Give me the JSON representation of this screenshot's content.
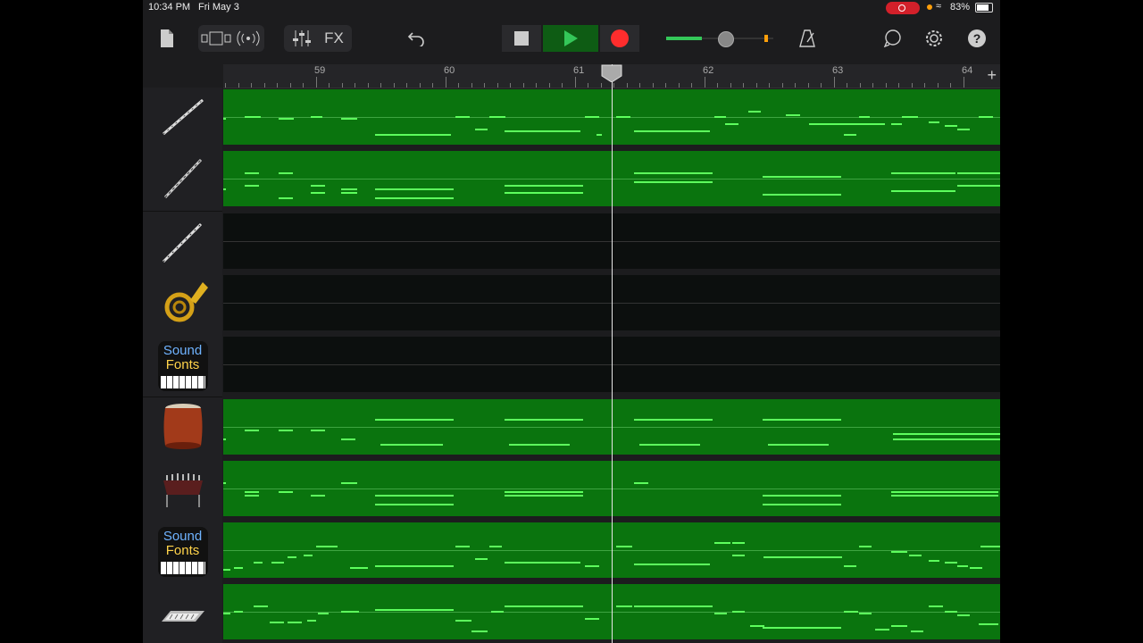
{
  "status": {
    "time": "10:34 PM",
    "date": "Fri May 3",
    "battery": "83%"
  },
  "toolbar": {
    "fx_label": "FX",
    "help_label": "?"
  },
  "ruler": {
    "bars": [
      "59",
      "60",
      "61",
      "62",
      "63",
      "64"
    ]
  },
  "tracks": [
    {
      "name": "bassoon",
      "icon": "bassoon-icon",
      "empty": false,
      "notes": [
        [
          0,
          32,
          3
        ],
        [
          24,
          30,
          18
        ],
        [
          62,
          32,
          17
        ],
        [
          98,
          30,
          13
        ],
        [
          132,
          32,
          18
        ],
        [
          170,
          50,
          85
        ],
        [
          260,
          30,
          16
        ],
        [
          282,
          44,
          14
        ],
        [
          298,
          30,
          18
        ],
        [
          315,
          46,
          85
        ],
        [
          405,
          30,
          16
        ],
        [
          418,
          50,
          6
        ],
        [
          440,
          30,
          16
        ],
        [
          460,
          46,
          85
        ],
        [
          550,
          30,
          13
        ],
        [
          562,
          38,
          15
        ],
        [
          588,
          24,
          14
        ],
        [
          630,
          28,
          16
        ],
        [
          656,
          38,
          85
        ],
        [
          695,
          50,
          14
        ],
        [
          712,
          30,
          12
        ],
        [
          748,
          38,
          12
        ],
        [
          760,
          30,
          18
        ],
        [
          790,
          36,
          12
        ],
        [
          808,
          40,
          14
        ],
        [
          822,
          44,
          14
        ],
        [
          846,
          30,
          16
        ]
      ]
    },
    {
      "name": "oboe",
      "icon": "oboe-icon",
      "empty": false,
      "notes": [
        [
          0,
          42,
          3
        ],
        [
          24,
          24,
          16
        ],
        [
          24,
          38,
          16
        ],
        [
          62,
          24,
          16
        ],
        [
          62,
          52,
          16
        ],
        [
          98,
          38,
          16
        ],
        [
          98,
          46,
          16
        ],
        [
          132,
          42,
          18
        ],
        [
          132,
          46,
          18
        ],
        [
          170,
          42,
          88
        ],
        [
          170,
          52,
          88
        ],
        [
          315,
          38,
          88
        ],
        [
          315,
          46,
          88
        ],
        [
          460,
          24,
          88
        ],
        [
          460,
          34,
          88
        ],
        [
          604,
          28,
          88
        ],
        [
          604,
          48,
          88
        ],
        [
          748,
          24,
          72
        ],
        [
          748,
          44,
          72
        ],
        [
          822,
          24,
          48
        ],
        [
          822,
          38,
          48
        ]
      ]
    },
    {
      "name": "clarinet",
      "icon": "clarinet-icon",
      "empty": true,
      "notes": []
    },
    {
      "name": "french-horn",
      "icon": "french-horn-icon",
      "empty": true,
      "notes": []
    },
    {
      "name": "soundfonts-piano",
      "icon": "soundfonts-icon",
      "label1": "Sound",
      "label2": "Fonts",
      "empty": true,
      "notes": []
    },
    {
      "name": "taiko-drum",
      "icon": "taiko-drum-icon",
      "empty": false,
      "notes": [
        [
          0,
          44,
          3
        ],
        [
          24,
          34,
          16
        ],
        [
          62,
          34,
          16
        ],
        [
          98,
          34,
          16
        ],
        [
          132,
          44,
          16
        ],
        [
          170,
          22,
          88
        ],
        [
          176,
          50,
          70
        ],
        [
          315,
          22,
          88
        ],
        [
          320,
          50,
          68
        ],
        [
          460,
          22,
          88
        ],
        [
          466,
          50,
          68
        ],
        [
          604,
          22,
          88
        ],
        [
          610,
          50,
          68
        ],
        [
          750,
          38,
          120
        ],
        [
          750,
          44,
          120
        ]
      ]
    },
    {
      "name": "vibraphone",
      "icon": "vibraphone-icon",
      "empty": false,
      "notes": [
        [
          0,
          24,
          3
        ],
        [
          24,
          34,
          16
        ],
        [
          24,
          38,
          16
        ],
        [
          62,
          34,
          16
        ],
        [
          98,
          38,
          16
        ],
        [
          132,
          24,
          18
        ],
        [
          170,
          38,
          88
        ],
        [
          170,
          48,
          88
        ],
        [
          315,
          34,
          88
        ],
        [
          315,
          38,
          88
        ],
        [
          460,
          24,
          16
        ],
        [
          604,
          38,
          88
        ],
        [
          604,
          48,
          88
        ],
        [
          748,
          34,
          120
        ],
        [
          748,
          38,
          120
        ]
      ]
    },
    {
      "name": "soundfonts-strings",
      "icon": "soundfonts-icon",
      "label1": "Sound",
      "label2": "Fonts",
      "empty": false,
      "notes": [
        [
          0,
          52,
          8
        ],
        [
          12,
          50,
          10
        ],
        [
          34,
          44,
          10
        ],
        [
          54,
          44,
          14
        ],
        [
          72,
          38,
          10
        ],
        [
          90,
          36,
          10
        ],
        [
          104,
          26,
          24
        ],
        [
          142,
          50,
          20
        ],
        [
          170,
          48,
          88
        ],
        [
          260,
          26,
          16
        ],
        [
          282,
          40,
          14
        ],
        [
          298,
          26,
          14
        ],
        [
          315,
          44,
          85
        ],
        [
          405,
          48,
          16
        ],
        [
          440,
          26,
          18
        ],
        [
          460,
          46,
          85
        ],
        [
          550,
          22,
          18
        ],
        [
          570,
          22,
          14
        ],
        [
          570,
          36,
          14
        ],
        [
          605,
          38,
          88
        ],
        [
          695,
          48,
          14
        ],
        [
          712,
          26,
          14
        ],
        [
          748,
          32,
          18
        ],
        [
          768,
          36,
          14
        ],
        [
          790,
          42,
          12
        ],
        [
          808,
          44,
          14
        ],
        [
          822,
          48,
          12
        ],
        [
          836,
          50,
          14
        ],
        [
          848,
          26,
          22
        ]
      ]
    },
    {
      "name": "synth",
      "icon": "synth-icon",
      "empty": false,
      "notes": [
        [
          0,
          32,
          8
        ],
        [
          12,
          30,
          10
        ],
        [
          34,
          24,
          16
        ],
        [
          52,
          42,
          16
        ],
        [
          72,
          42,
          16
        ],
        [
          94,
          40,
          10
        ],
        [
          106,
          32,
          12
        ],
        [
          132,
          30,
          20
        ],
        [
          170,
          28,
          88
        ],
        [
          260,
          40,
          18
        ],
        [
          278,
          52,
          18
        ],
        [
          300,
          30,
          14
        ],
        [
          315,
          24,
          88
        ],
        [
          405,
          38,
          16
        ],
        [
          440,
          24,
          18
        ],
        [
          460,
          24,
          88
        ],
        [
          550,
          32,
          14
        ],
        [
          570,
          30,
          14
        ],
        [
          590,
          46,
          16
        ],
        [
          604,
          48,
          88
        ],
        [
          695,
          30,
          16
        ],
        [
          712,
          32,
          14
        ],
        [
          730,
          50,
          16
        ],
        [
          748,
          46,
          18
        ],
        [
          770,
          52,
          14
        ],
        [
          790,
          24,
          16
        ],
        [
          808,
          30,
          14
        ],
        [
          822,
          34,
          14
        ],
        [
          846,
          44,
          22
        ]
      ]
    }
  ],
  "colors": {
    "accent_green": "#5dff5d",
    "lane_green": "#0a740e",
    "record_red": "#ff2d2d",
    "play_green": "#34c759"
  }
}
